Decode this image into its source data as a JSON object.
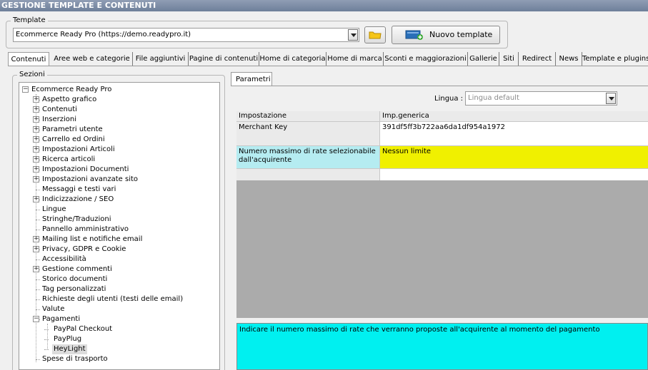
{
  "window": {
    "title": "GESTIONE TEMPLATE E CONTENUTI"
  },
  "template_group": {
    "label": "Template",
    "selected": "Ecommerce Ready Pro (https://demo.readypro.it)",
    "new_button_label": "Nuovo template",
    "folder_icon": "folder-icon",
    "new_icon": "new-template-icon"
  },
  "tabs": [
    {
      "label": "Contenuti"
    },
    {
      "label": "Aree web e categorie"
    },
    {
      "label": "File aggiuntivi"
    },
    {
      "label": "Pagine di contenuti"
    },
    {
      "label": "Home di categoria"
    },
    {
      "label": "Home di marca"
    },
    {
      "label": "Sconti e maggiorazioni"
    },
    {
      "label": "Gallerie"
    },
    {
      "label": "Siti"
    },
    {
      "label": "Redirect"
    },
    {
      "label": "News"
    },
    {
      "label": "Template e plugins"
    }
  ],
  "sections": {
    "label": "Sezioni",
    "root": "Ecommerce Ready Pro",
    "items": [
      {
        "label": "Aspetto grafico",
        "expandable": true
      },
      {
        "label": "Contenuti",
        "expandable": true
      },
      {
        "label": "Inserzioni",
        "expandable": true
      },
      {
        "label": "Parametri utente",
        "expandable": true
      },
      {
        "label": "Carrello ed Ordini",
        "expandable": true
      },
      {
        "label": "Impostazioni Articoli",
        "expandable": true
      },
      {
        "label": "Ricerca articoli",
        "expandable": true
      },
      {
        "label": "Impostazioni Documenti",
        "expandable": true
      },
      {
        "label": "Impostazioni avanzate sito",
        "expandable": true
      },
      {
        "label": "Messaggi e testi vari",
        "expandable": false
      },
      {
        "label": "Indicizzazione / SEO",
        "expandable": true
      },
      {
        "label": "Lingue",
        "expandable": false
      },
      {
        "label": "Stringhe/Traduzioni",
        "expandable": false
      },
      {
        "label": "Pannello amministrativo",
        "expandable": false
      },
      {
        "label": "Mailing list e notifiche email",
        "expandable": true
      },
      {
        "label": "Privacy, GDPR e Cookie",
        "expandable": true
      },
      {
        "label": "Accessibilità",
        "expandable": false
      },
      {
        "label": "Gestione commenti",
        "expandable": true
      },
      {
        "label": "Storico documenti",
        "expandable": false
      },
      {
        "label": "Tag personalizzati",
        "expandable": false
      },
      {
        "label": "Richieste degli utenti (testi delle email)",
        "expandable": false
      },
      {
        "label": "Valute",
        "expandable": false
      },
      {
        "label": "Pagamenti",
        "expandable": true,
        "expanded": true
      },
      {
        "label": "PayPal Checkout",
        "child": true
      },
      {
        "label": "PayPlug",
        "child": true
      },
      {
        "label": "HeyLight",
        "child": true,
        "selected": true
      },
      {
        "label": "Spese di trasporto",
        "expandable": false
      }
    ]
  },
  "params": {
    "tab_label": "Parametri",
    "lingua_label": "Lingua :",
    "lingua_value": "Lingua default",
    "col_setting": "Impostazione",
    "col_value": "Imp.generica",
    "rows": [
      {
        "setting": "Merchant Key",
        "value": "391df5ff3b722aa6da1df954a1972"
      },
      {
        "setting": "Numero massimo di rate selezionabile dall'acquirente",
        "value": "Nessun limite"
      }
    ],
    "description": "Indicare il numero massimo di rate che verranno proposte all'acquirente al momento del pagamento"
  },
  "colors": {
    "selected_row": "#b5ecf1",
    "selected_value": "#f0f000",
    "description_bg": "#00f0f0",
    "empty_area": "#ababab"
  }
}
